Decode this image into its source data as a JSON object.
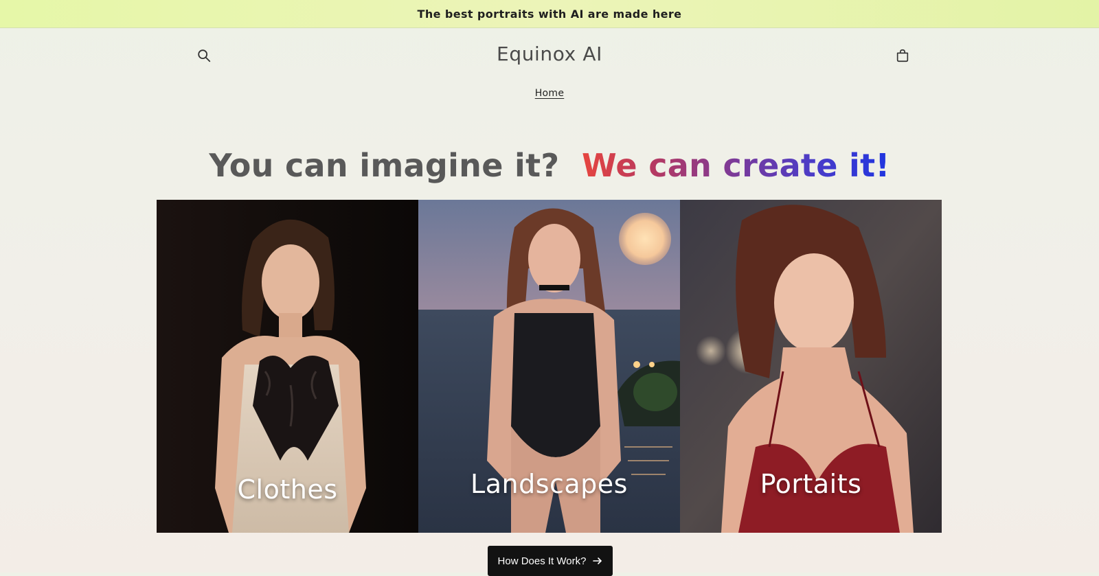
{
  "announcement": {
    "text": "The best portraits with AI are made here"
  },
  "header": {
    "logo": "Equinox AI",
    "search_icon": "search-icon",
    "cart_icon": "cart-icon"
  },
  "nav": {
    "home_label": "Home"
  },
  "hero": {
    "headline_plain": "You can imagine it?",
    "headline_accent": "We can create it!",
    "accent_colors": [
      "#e6453f",
      "#7a3a9a",
      "#1f35e0"
    ]
  },
  "gallery": {
    "tiles": [
      {
        "label": "Clothes"
      },
      {
        "label": "Landscapes"
      },
      {
        "label": "Portaits"
      }
    ]
  },
  "cta": {
    "label": "How Does It Work?",
    "icon": "arrow-right-icon"
  }
}
